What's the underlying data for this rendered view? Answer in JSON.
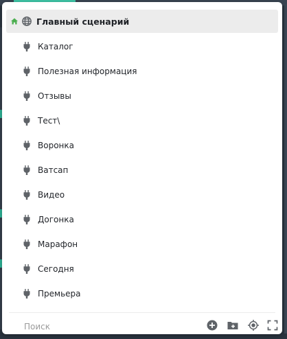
{
  "tree": {
    "root": {
      "label": "Главный сценарий",
      "home_icon": "home-icon",
      "icon": "globe-icon"
    },
    "items": [
      {
        "label": "Каталог",
        "icon": "plug-icon"
      },
      {
        "label": "Полезная информация",
        "icon": "plug-icon"
      },
      {
        "label": "Отзывы",
        "icon": "plug-icon"
      },
      {
        "label": "Тест\\",
        "icon": "plug-icon"
      },
      {
        "label": "Воронка",
        "icon": "plug-icon"
      },
      {
        "label": "Ватсап",
        "icon": "plug-icon"
      },
      {
        "label": "Видео",
        "icon": "plug-icon"
      },
      {
        "label": "Догонка",
        "icon": "plug-icon"
      },
      {
        "label": "Марафон",
        "icon": "plug-icon"
      },
      {
        "label": "Сегодня",
        "icon": "plug-icon"
      },
      {
        "label": "Премьера",
        "icon": "plug-icon"
      }
    ]
  },
  "footer": {
    "search_placeholder": "Поиск",
    "search_value": "",
    "actions": [
      "add-circle-icon",
      "add-folder-icon",
      "target-icon",
      "fullscreen-icon"
    ]
  },
  "colors": {
    "home": "#4caf50",
    "icon": "#5f6368",
    "root_background": "#ececec",
    "text": "#1f2227"
  }
}
